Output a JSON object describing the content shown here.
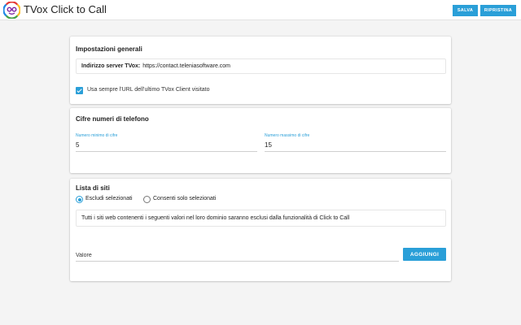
{
  "header": {
    "title": "TVox Click to Call",
    "save_label": "SALVA",
    "reset_label": "RIPRISTINA"
  },
  "general": {
    "title": "Impostazioni generali",
    "server_label": "Indirizzo server TVox:",
    "server_value": "https://contact.teleniasoftware.com",
    "use_last_url_label": "Usa sempre l'URL dell'ultimo TVox Client visitato",
    "use_last_url_checked": true
  },
  "digits": {
    "title": "Cifre numeri di telefono",
    "min_label": "Numero minimo di cifre",
    "min_value": "5",
    "max_label": "Numero massimo di cifre",
    "max_value": "15"
  },
  "sites": {
    "title": "Lista di siti",
    "exclude_label": "Escludi selezionati",
    "allow_label": "Consenti solo selezionati",
    "selected_mode": "exclude",
    "info_text": "Tutti i siti web contenenti i seguenti valori nel loro dominio saranno esclusi dalla funzionalità di Click to Call",
    "value_placeholder": "Valore",
    "add_label": "AGGIUNGI"
  },
  "colors": {
    "accent": "#2a9fd8",
    "background": "#f4f4f4"
  }
}
